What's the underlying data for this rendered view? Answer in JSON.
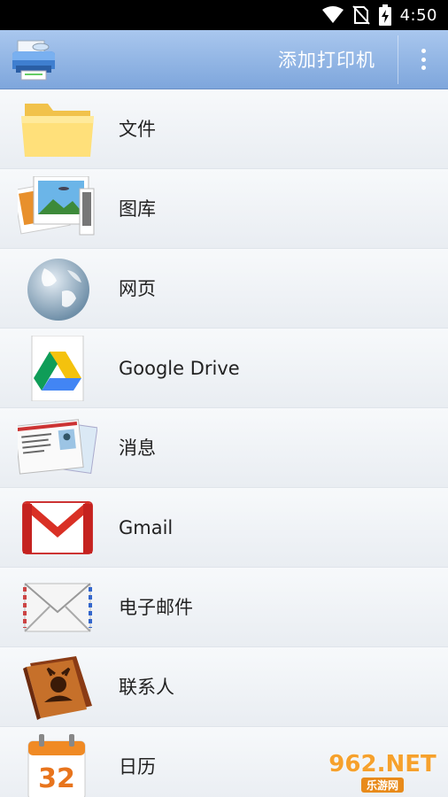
{
  "status_bar": {
    "time": "4:50",
    "icons": [
      "wifi-icon",
      "no-sim-icon",
      "battery-charging-icon"
    ]
  },
  "app_bar": {
    "logo_icon": "printer-logo-icon",
    "action_label": "添加打印机",
    "overflow_icon": "more-vert-icon"
  },
  "menu": {
    "items": [
      {
        "label": "文件",
        "icon": "folder-icon"
      },
      {
        "label": "图库",
        "icon": "photos-icon"
      },
      {
        "label": "网页",
        "icon": "globe-icon"
      },
      {
        "label": "Google Drive",
        "icon": "google-drive-icon"
      },
      {
        "label": "消息",
        "icon": "messages-icon"
      },
      {
        "label": "Gmail",
        "icon": "gmail-icon"
      },
      {
        "label": "电子邮件",
        "icon": "email-envelope-icon"
      },
      {
        "label": "联系人",
        "icon": "contacts-book-icon"
      },
      {
        "label": "日历",
        "icon": "calendar-icon"
      }
    ]
  },
  "calendar_icon_day": "32",
  "watermark": {
    "main": "962.NET",
    "sub": "乐游网"
  },
  "colors": {
    "app_bar": "#8fb3e4",
    "status_bar": "#000000",
    "row_bg": "#f3f5f8"
  }
}
